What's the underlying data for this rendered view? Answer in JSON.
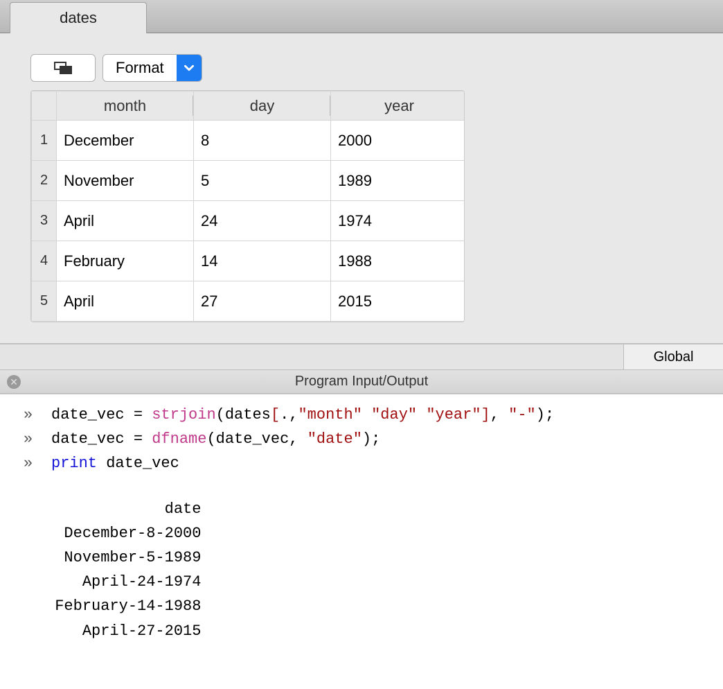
{
  "tab": {
    "title": "dates"
  },
  "toolbar": {
    "format_label": "Format"
  },
  "table": {
    "columns": [
      "month",
      "day",
      "year"
    ],
    "rows": [
      {
        "n": "1",
        "month": "December",
        "day": "8",
        "year": "2000"
      },
      {
        "n": "2",
        "month": "November",
        "day": "5",
        "year": "1989"
      },
      {
        "n": "3",
        "month": "April",
        "day": "24",
        "year": "1974"
      },
      {
        "n": "4",
        "month": "February",
        "day": "14",
        "year": "1988"
      },
      {
        "n": "5",
        "month": "April",
        "day": "27",
        "year": "2015"
      }
    ]
  },
  "scope": {
    "label": "Global"
  },
  "io": {
    "title": "Program Input/Output"
  },
  "code": {
    "lines": [
      {
        "segments": [
          {
            "t": "date_vec = ",
            "c": ""
          },
          {
            "t": "strjoin",
            "c": "tok-fn"
          },
          {
            "t": "(dates",
            "c": ""
          },
          {
            "t": "[",
            "c": "tok-br"
          },
          {
            "t": ".,",
            "c": ""
          },
          {
            "t": "\"month\" \"day\" \"year\"",
            "c": "tok-str"
          },
          {
            "t": "]",
            "c": "tok-br"
          },
          {
            "t": ", ",
            "c": ""
          },
          {
            "t": "\"-\"",
            "c": "tok-str"
          },
          {
            "t": ");",
            "c": ""
          }
        ]
      },
      {
        "segments": [
          {
            "t": "date_vec = ",
            "c": ""
          },
          {
            "t": "dfname",
            "c": "tok-fn"
          },
          {
            "t": "(date_vec, ",
            "c": ""
          },
          {
            "t": "\"date\"",
            "c": "tok-str"
          },
          {
            "t": ");",
            "c": ""
          }
        ]
      },
      {
        "segments": [
          {
            "t": "print",
            "c": "tok-kw"
          },
          {
            "t": " date_vec",
            "c": ""
          }
        ]
      }
    ]
  },
  "output": {
    "header": "date",
    "rows": [
      "December-8-2000",
      "November-5-1989",
      "April-24-1974",
      "February-14-1988",
      "April-27-2015"
    ]
  },
  "prompt_symbol": "»"
}
